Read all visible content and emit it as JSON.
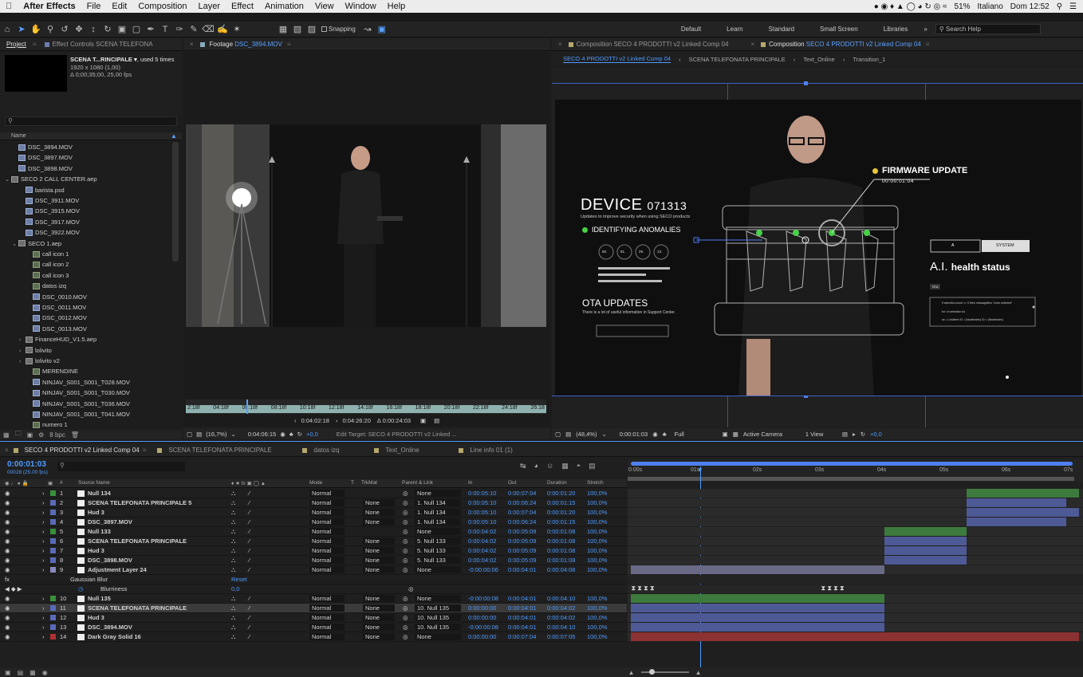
{
  "menubar": {
    "apple": "",
    "app": "After Effects",
    "items": [
      "File",
      "Edit",
      "Composition",
      "Layer",
      "Effect",
      "Animation",
      "View",
      "Window",
      "Help"
    ],
    "battery": "51%",
    "language": "Italiano",
    "clock": "Dom 12:52"
  },
  "toolbar": {
    "snapping": "Snapping",
    "workspaces": [
      "Default",
      "Learn",
      "Standard",
      "Small Screen",
      "Libraries"
    ],
    "search": "Search Help"
  },
  "project": {
    "tab": "Project",
    "tab2": "Effect Controls SCENA TELEFONA",
    "selected": "SCENA T...RINCIPALE ▾",
    "used": ", used 5 times",
    "dims": "1920 x 1080 (1,00)",
    "duration": "Δ 0;00;35;00, 25,00 fps",
    "col_name": "Name",
    "bpc": "8 bpc",
    "items": [
      {
        "name": "DSC_3894.MOV",
        "indent": 1,
        "kind": "v"
      },
      {
        "name": "DSC_3897.MOV",
        "indent": 1,
        "kind": "v"
      },
      {
        "name": "DSC_3898.MOV",
        "indent": 1,
        "kind": "v"
      },
      {
        "name": "SECO 2 CALL CENTER.aep",
        "indent": 0,
        "kind": "f"
      },
      {
        "name": "barista.psd",
        "indent": 2,
        "kind": "v"
      },
      {
        "name": "DSC_3911.MOV",
        "indent": 2,
        "kind": "v"
      },
      {
        "name": "DSC_3915.MOV",
        "indent": 2,
        "kind": "v"
      },
      {
        "name": "DSC_3917.MOV",
        "indent": 2,
        "kind": "v"
      },
      {
        "name": "DSC_3922.MOV",
        "indent": 2,
        "kind": "v"
      },
      {
        "name": "SECO 1.aep",
        "indent": 1,
        "kind": "f"
      },
      {
        "name": "call icon 1",
        "indent": 3,
        "kind": "c"
      },
      {
        "name": "call icon 2",
        "indent": 3,
        "kind": "c"
      },
      {
        "name": "call icon 3",
        "indent": 3,
        "kind": "c"
      },
      {
        "name": "datos izq",
        "indent": 3,
        "kind": "c"
      },
      {
        "name": "DSC_0010.MOV",
        "indent": 3,
        "kind": "v"
      },
      {
        "name": "DSC_0011.MOV",
        "indent": 3,
        "kind": "v"
      },
      {
        "name": "DSC_0012.MOV",
        "indent": 3,
        "kind": "v"
      },
      {
        "name": "DSC_0013.MOV",
        "indent": 3,
        "kind": "v"
      },
      {
        "name": "FinanceHUD_V1.5.aep",
        "indent": 2,
        "kind": "f"
      },
      {
        "name": "lolivito",
        "indent": 2,
        "kind": "f"
      },
      {
        "name": "lolivito v2",
        "indent": 2,
        "kind": "f"
      },
      {
        "name": "MERENDINE",
        "indent": 3,
        "kind": "c"
      },
      {
        "name": "NINJAV_S001_S001_T028.MOV",
        "indent": 3,
        "kind": "v"
      },
      {
        "name": "NINJAV_S001_S001_T030.MOV",
        "indent": 3,
        "kind": "v"
      },
      {
        "name": "NINJAV_S001_S001_T036.MOV",
        "indent": 3,
        "kind": "v"
      },
      {
        "name": "NINJAV_S001_S001_T041.MOV",
        "indent": 3,
        "kind": "v"
      },
      {
        "name": "numero 1",
        "indent": 3,
        "kind": "c"
      }
    ]
  },
  "footage": {
    "tab": "Footage",
    "tab_file": "DSC_3894.MOV",
    "ruler": [
      "2:18f",
      "04:18f",
      "06:18f",
      "08:18f",
      "10:18f",
      "12:18f",
      "14:18f",
      "16:18f",
      "18:18f",
      "20:18f",
      "22:18f",
      "24:18f",
      "26:18"
    ],
    "in": "0:04:02:18",
    "out": "0:04:26:20",
    "dur": "Δ 0:00:24:03",
    "zoom": "(16,7%)",
    "tc": "0:04:06:15",
    "exposure": "+0,0",
    "target": "Edit Target: SECO 4 PRODOTTI v2 Linked ..."
  },
  "comp": {
    "tab1": "Composition SECO 4 PRODOTTI v2 Linked Comp 04",
    "tab2_prefix": "Composition",
    "tab2": "SECO 4 PRODOTTI v2 Linked Comp 04",
    "crumbs": [
      "SECO 4 PRODOTTI v2 Linked Comp 04",
      "SCENA TELEFONATA PRINCIPALE",
      "Text_Online",
      "Transition_1"
    ],
    "zoom": "(48,4%)",
    "tc": "0:00:01:03",
    "res": "Full",
    "camera": "Active Camera",
    "view": "1 View",
    "exposure": "+0,0"
  },
  "hud": {
    "device": "DEVICE",
    "device_num": "071313",
    "device_sub": "Updates to improve security when using SECO products",
    "identifying": "IDENTIFYING ANOMALIES",
    "gauges": [
      "50.",
      "81.",
      "28.",
      "13."
    ],
    "ota": "OTA UPDATES",
    "ota_sub": "There is a lot of useful information in Support Center.",
    "firmware": "FIRMWARE UPDATE",
    "fw_tc": "00:00:01:04",
    "btn_a": "A",
    "btn_system": "SYSTEM",
    "ai": "A.I.",
    "ai_health": "health status",
    "sta": "STA",
    "code": [
      "if selection.count == 0 then messageBox \"none selected\"",
      "for i in selection do",
      "ss = i.children ID = (NodeIndex) ID = (NodeIndex)"
    ],
    "colors": {
      "green": "#47d147",
      "yellow": "#e8c63a"
    }
  },
  "timeline": {
    "tabs": [
      "SECO 4 PRODOTTI v2 Linked Comp 04",
      "SCENA TELEFONATA PRINCIPALE",
      "datos izq",
      "Text_Online",
      "Line info 01 (1)"
    ],
    "tc": "0:00:01:03",
    "frames": "00028 (25.00 fps)",
    "headers": {
      "num": "#",
      "source": "Source Name",
      "mode": "Mode",
      "t": "T",
      "trkmat": "TrkMat",
      "parent": "Parent & Link",
      "in": "In",
      "out": "Out",
      "duration": "Duration",
      "stretch": "Stretch"
    },
    "ruler": [
      "0:00s",
      "01s",
      "02s",
      "03s",
      "04s",
      "05s",
      "06s",
      "07s"
    ],
    "layers": [
      {
        "n": "1",
        "label": "#3a8f3a",
        "name": "Null 134",
        "mode": "Normal",
        "trk": "",
        "parent": "None",
        "in": "0:00:05:10",
        "out": "0:00:07:04",
        "dur": "0:00:01:20",
        "stretch": "100,0%"
      },
      {
        "n": "2",
        "label": "#5a6ab8",
        "name": "SCENA TELEFONATA PRINCIPALE 5",
        "mode": "Normal",
        "trk": "None",
        "parent": "1. Null 134",
        "in": "0:00:05:10",
        "out": "0:00:06:24",
        "dur": "0:00:01:15",
        "stretch": "100,0%"
      },
      {
        "n": "3",
        "label": "#5a6ab8",
        "name": "Hud 3",
        "mode": "Normal",
        "trk": "None",
        "parent": "1. Null 134",
        "in": "0:00:05:10",
        "out": "0:00:07:04",
        "dur": "0:00:01:20",
        "stretch": "100,0%"
      },
      {
        "n": "4",
        "label": "#5a6ab8",
        "name": "DSC_3897.MOV",
        "mode": "Normal",
        "trk": "None",
        "parent": "1. Null 134",
        "in": "0:00:05:10",
        "out": "0:00:06:24",
        "dur": "0:00:01:15",
        "stretch": "100,0%"
      },
      {
        "n": "5",
        "label": "#3a8f3a",
        "name": "Null 133",
        "mode": "Normal",
        "trk": "",
        "parent": "None",
        "in": "0:00:04:02",
        "out": "0:00:05:09",
        "dur": "0:00:01:08",
        "stretch": "100,0%"
      },
      {
        "n": "6",
        "label": "#5a6ab8",
        "name": "SCENA TELEFONATA PRINCIPALE",
        "mode": "Normal",
        "trk": "None",
        "parent": "5. Null 133",
        "in": "0:00:04:02",
        "out": "0:00:05:09",
        "dur": "0:00:01:08",
        "stretch": "100,0%"
      },
      {
        "n": "7",
        "label": "#5a6ab8",
        "name": "Hud 3",
        "mode": "Normal",
        "trk": "None",
        "parent": "5. Null 133",
        "in": "0:00:04:02",
        "out": "0:00:05:09",
        "dur": "0:00:01:08",
        "stretch": "100,0%"
      },
      {
        "n": "8",
        "label": "#5a6ab8",
        "name": "DSC_3898.MOV",
        "mode": "Normal",
        "trk": "None",
        "parent": "5. Null 133",
        "in": "0:00:04:02",
        "out": "0:00:05:09",
        "dur": "0:00:01:08",
        "stretch": "100,0%"
      },
      {
        "n": "9",
        "label": "#8a8ac0",
        "name": "Adjustment Layer 24",
        "mode": "Normal",
        "trk": "None",
        "parent": "None",
        "in": "-0:00:00:06",
        "out": "0:00:04:01",
        "dur": "0:00:04:08",
        "stretch": "100,0%"
      },
      {
        "n": "10",
        "label": "#3a8f3a",
        "name": "Null 135",
        "mode": "Normal",
        "trk": "None",
        "parent": "None",
        "in": "-0:00:00:08",
        "out": "0:00:04:01",
        "dur": "0:00:04:10",
        "stretch": "100,0%"
      },
      {
        "n": "11",
        "label": "#5a6ab8",
        "name": "SCENA TELEFONATA PRINCIPALE",
        "mode": "Normal",
        "trk": "None",
        "parent": "10. Null 135",
        "in": "0:00:00:00",
        "out": "0:00:04:01",
        "dur": "0:00:04:02",
        "stretch": "100,0%"
      },
      {
        "n": "12",
        "label": "#5a6ab8",
        "name": "Hud 3",
        "mode": "Normal",
        "trk": "None",
        "parent": "10. Null 135",
        "in": "0:00:00:00",
        "out": "0:00:04:01",
        "dur": "0:00:04:02",
        "stretch": "100,0%"
      },
      {
        "n": "13",
        "label": "#5a6ab8",
        "name": "DSC_3894.MOV",
        "mode": "Normal",
        "trk": "None",
        "parent": "10. Null 135",
        "in": "-0:00:00:08",
        "out": "0:00:04:01",
        "dur": "0:00:04:10",
        "stretch": "100,0%"
      },
      {
        "n": "14",
        "label": "#b03030",
        "name": "Dark Gray Solid 16",
        "mode": "Normal",
        "trk": "None",
        "parent": "None",
        "in": "0:00:00:00",
        "out": "0:00:07:04",
        "dur": "0:00:07:05",
        "stretch": "100,0%"
      }
    ],
    "effect": {
      "fx": "fx",
      "name": "Gaussian Blur",
      "reset": "Reset",
      "param": "Blurriness",
      "value": "0,0"
    }
  }
}
